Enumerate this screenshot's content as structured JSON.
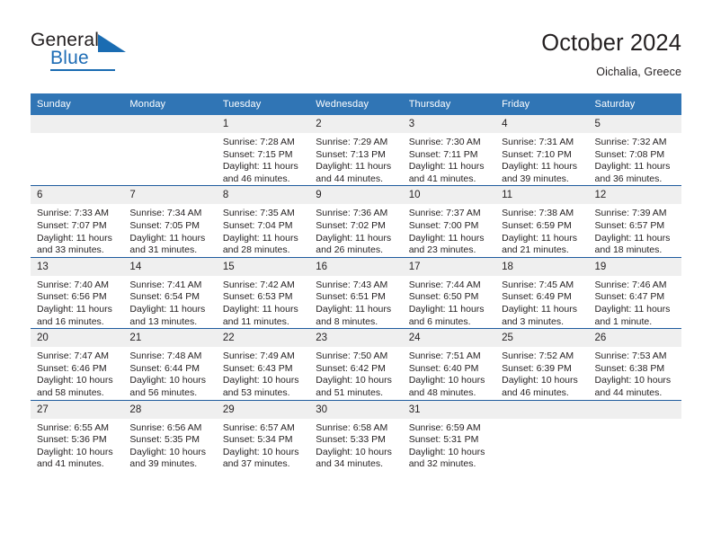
{
  "brand": {
    "name_part1": "General",
    "name_part2": "Blue",
    "accent_color": "#1a6cb2"
  },
  "header": {
    "title": "October 2024",
    "location": "Oichalia, Greece"
  },
  "theme": {
    "header_bg": "#3075b5",
    "row_divider": "#1f5c9e",
    "daynum_bg": "#efefef"
  },
  "weekdays": [
    "Sunday",
    "Monday",
    "Tuesday",
    "Wednesday",
    "Thursday",
    "Friday",
    "Saturday"
  ],
  "labels": {
    "sunrise_prefix": "Sunrise:",
    "sunset_prefix": "Sunset:",
    "daylight_prefix": "Daylight:"
  },
  "weeks": [
    [
      {
        "day": "",
        "sunrise": "",
        "sunset": "",
        "daylight": ""
      },
      {
        "day": "",
        "sunrise": "",
        "sunset": "",
        "daylight": ""
      },
      {
        "day": "1",
        "sunrise": "Sunrise: 7:28 AM",
        "sunset": "Sunset: 7:15 PM",
        "daylight": "Daylight: 11 hours and 46 minutes."
      },
      {
        "day": "2",
        "sunrise": "Sunrise: 7:29 AM",
        "sunset": "Sunset: 7:13 PM",
        "daylight": "Daylight: 11 hours and 44 minutes."
      },
      {
        "day": "3",
        "sunrise": "Sunrise: 7:30 AM",
        "sunset": "Sunset: 7:11 PM",
        "daylight": "Daylight: 11 hours and 41 minutes."
      },
      {
        "day": "4",
        "sunrise": "Sunrise: 7:31 AM",
        "sunset": "Sunset: 7:10 PM",
        "daylight": "Daylight: 11 hours and 39 minutes."
      },
      {
        "day": "5",
        "sunrise": "Sunrise: 7:32 AM",
        "sunset": "Sunset: 7:08 PM",
        "daylight": "Daylight: 11 hours and 36 minutes."
      }
    ],
    [
      {
        "day": "6",
        "sunrise": "Sunrise: 7:33 AM",
        "sunset": "Sunset: 7:07 PM",
        "daylight": "Daylight: 11 hours and 33 minutes."
      },
      {
        "day": "7",
        "sunrise": "Sunrise: 7:34 AM",
        "sunset": "Sunset: 7:05 PM",
        "daylight": "Daylight: 11 hours and 31 minutes."
      },
      {
        "day": "8",
        "sunrise": "Sunrise: 7:35 AM",
        "sunset": "Sunset: 7:04 PM",
        "daylight": "Daylight: 11 hours and 28 minutes."
      },
      {
        "day": "9",
        "sunrise": "Sunrise: 7:36 AM",
        "sunset": "Sunset: 7:02 PM",
        "daylight": "Daylight: 11 hours and 26 minutes."
      },
      {
        "day": "10",
        "sunrise": "Sunrise: 7:37 AM",
        "sunset": "Sunset: 7:00 PM",
        "daylight": "Daylight: 11 hours and 23 minutes."
      },
      {
        "day": "11",
        "sunrise": "Sunrise: 7:38 AM",
        "sunset": "Sunset: 6:59 PM",
        "daylight": "Daylight: 11 hours and 21 minutes."
      },
      {
        "day": "12",
        "sunrise": "Sunrise: 7:39 AM",
        "sunset": "Sunset: 6:57 PM",
        "daylight": "Daylight: 11 hours and 18 minutes."
      }
    ],
    [
      {
        "day": "13",
        "sunrise": "Sunrise: 7:40 AM",
        "sunset": "Sunset: 6:56 PM",
        "daylight": "Daylight: 11 hours and 16 minutes."
      },
      {
        "day": "14",
        "sunrise": "Sunrise: 7:41 AM",
        "sunset": "Sunset: 6:54 PM",
        "daylight": "Daylight: 11 hours and 13 minutes."
      },
      {
        "day": "15",
        "sunrise": "Sunrise: 7:42 AM",
        "sunset": "Sunset: 6:53 PM",
        "daylight": "Daylight: 11 hours and 11 minutes."
      },
      {
        "day": "16",
        "sunrise": "Sunrise: 7:43 AM",
        "sunset": "Sunset: 6:51 PM",
        "daylight": "Daylight: 11 hours and 8 minutes."
      },
      {
        "day": "17",
        "sunrise": "Sunrise: 7:44 AM",
        "sunset": "Sunset: 6:50 PM",
        "daylight": "Daylight: 11 hours and 6 minutes."
      },
      {
        "day": "18",
        "sunrise": "Sunrise: 7:45 AM",
        "sunset": "Sunset: 6:49 PM",
        "daylight": "Daylight: 11 hours and 3 minutes."
      },
      {
        "day": "19",
        "sunrise": "Sunrise: 7:46 AM",
        "sunset": "Sunset: 6:47 PM",
        "daylight": "Daylight: 11 hours and 1 minute."
      }
    ],
    [
      {
        "day": "20",
        "sunrise": "Sunrise: 7:47 AM",
        "sunset": "Sunset: 6:46 PM",
        "daylight": "Daylight: 10 hours and 58 minutes."
      },
      {
        "day": "21",
        "sunrise": "Sunrise: 7:48 AM",
        "sunset": "Sunset: 6:44 PM",
        "daylight": "Daylight: 10 hours and 56 minutes."
      },
      {
        "day": "22",
        "sunrise": "Sunrise: 7:49 AM",
        "sunset": "Sunset: 6:43 PM",
        "daylight": "Daylight: 10 hours and 53 minutes."
      },
      {
        "day": "23",
        "sunrise": "Sunrise: 7:50 AM",
        "sunset": "Sunset: 6:42 PM",
        "daylight": "Daylight: 10 hours and 51 minutes."
      },
      {
        "day": "24",
        "sunrise": "Sunrise: 7:51 AM",
        "sunset": "Sunset: 6:40 PM",
        "daylight": "Daylight: 10 hours and 48 minutes."
      },
      {
        "day": "25",
        "sunrise": "Sunrise: 7:52 AM",
        "sunset": "Sunset: 6:39 PM",
        "daylight": "Daylight: 10 hours and 46 minutes."
      },
      {
        "day": "26",
        "sunrise": "Sunrise: 7:53 AM",
        "sunset": "Sunset: 6:38 PM",
        "daylight": "Daylight: 10 hours and 44 minutes."
      }
    ],
    [
      {
        "day": "27",
        "sunrise": "Sunrise: 6:55 AM",
        "sunset": "Sunset: 5:36 PM",
        "daylight": "Daylight: 10 hours and 41 minutes."
      },
      {
        "day": "28",
        "sunrise": "Sunrise: 6:56 AM",
        "sunset": "Sunset: 5:35 PM",
        "daylight": "Daylight: 10 hours and 39 minutes."
      },
      {
        "day": "29",
        "sunrise": "Sunrise: 6:57 AM",
        "sunset": "Sunset: 5:34 PM",
        "daylight": "Daylight: 10 hours and 37 minutes."
      },
      {
        "day": "30",
        "sunrise": "Sunrise: 6:58 AM",
        "sunset": "Sunset: 5:33 PM",
        "daylight": "Daylight: 10 hours and 34 minutes."
      },
      {
        "day": "31",
        "sunrise": "Sunrise: 6:59 AM",
        "sunset": "Sunset: 5:31 PM",
        "daylight": "Daylight: 10 hours and 32 minutes."
      },
      {
        "day": "",
        "sunrise": "",
        "sunset": "",
        "daylight": ""
      },
      {
        "day": "",
        "sunrise": "",
        "sunset": "",
        "daylight": ""
      }
    ]
  ]
}
